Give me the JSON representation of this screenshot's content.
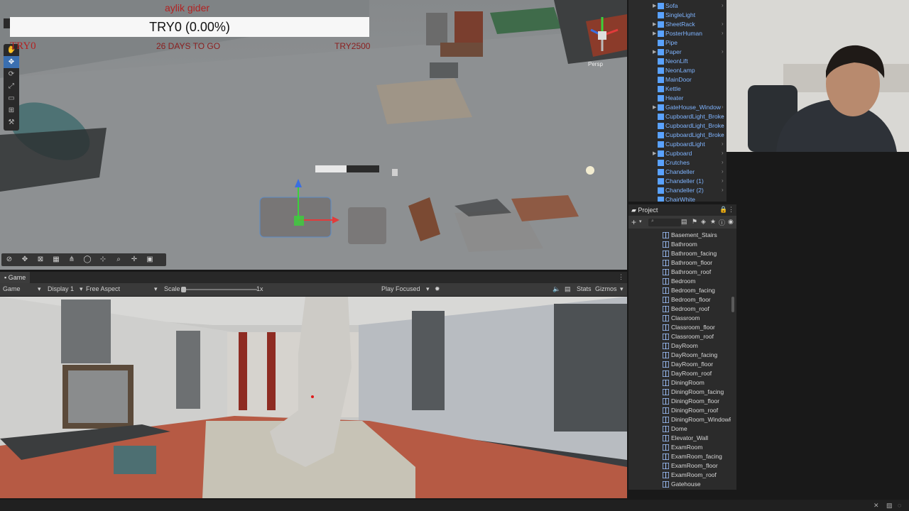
{
  "hud": {
    "alert": "aylik gider",
    "title": "TRY0 (0.00%)",
    "left_label": "TRY0",
    "days": "26 DAYS TO GO",
    "right_label": "TRY2500"
  },
  "scene": {
    "view_mode": "Persp",
    "tools": [
      "hand-tool-icon",
      "move-tool-icon",
      "rotate-tool-icon",
      "scale-tool-icon",
      "rect-tool-icon",
      "transform-tool-icon",
      "custom-tool-icon"
    ]
  },
  "game": {
    "tab_label": "Game",
    "mode_label": "Game",
    "display": "Display 1",
    "aspect": "Free Aspect",
    "scale_label": "Scale",
    "scale_value": "1x",
    "play_mode": "Play Focused",
    "stats_label": "Stats",
    "gizmos_label": "Gizmos"
  },
  "hierarchy": {
    "items": [
      {
        "label": "Sofa",
        "expandable": true
      },
      {
        "label": "SingleLight",
        "expandable": false
      },
      {
        "label": "SheetRack",
        "expandable": true
      },
      {
        "label": "PosterHuman",
        "expandable": true
      },
      {
        "label": "Pipe",
        "expandable": false
      },
      {
        "label": "Paper",
        "expandable": true
      },
      {
        "label": "NeonLift",
        "expandable": false
      },
      {
        "label": "NeonLamp",
        "expandable": false
      },
      {
        "label": "MainDoor",
        "expandable": false
      },
      {
        "label": "Kettle",
        "expandable": false
      },
      {
        "label": "Heater",
        "expandable": false
      },
      {
        "label": "GateHouse_Window",
        "expandable": true
      },
      {
        "label": "CupboardLight_Broke",
        "expandable": false
      },
      {
        "label": "CupboardLight_Broke",
        "expandable": false
      },
      {
        "label": "CupboardLight_Broke",
        "expandable": false
      },
      {
        "label": "CupboardLight",
        "expandable": false
      },
      {
        "label": "Cupboard",
        "expandable": true
      },
      {
        "label": "Crutches",
        "expandable": false
      },
      {
        "label": "Chandeller",
        "expandable": false
      },
      {
        "label": "Chandeller (1)",
        "expandable": false
      },
      {
        "label": "Chandeller (2)",
        "expandable": false
      },
      {
        "label": "ChairWhite",
        "expandable": false
      }
    ]
  },
  "project": {
    "tab_label": "Project",
    "items": [
      "Basement_Stairs",
      "Bathroom",
      "Bathroom_facing",
      "Bathroom_floor",
      "Bathroom_roof",
      "Bedroom",
      "Bedroom_facing",
      "Bedroom_floor",
      "Bedroom_roof",
      "Classroom",
      "Classroom_floor",
      "Classroom_roof",
      "DayRoom",
      "DayRoom_facing",
      "DayRoom_floor",
      "DayRoom_roof",
      "DiningRoom",
      "DiningRoom_facing",
      "DiningRoom_floor",
      "DiningRoom_roof",
      "DiningRoom_WindowF",
      "Dome",
      "Elevator_Wall",
      "ExamRoom",
      "ExamRoom_facing",
      "ExamRoom_floor",
      "ExamRoom_roof",
      "Gatehouse"
    ]
  },
  "colors": {
    "accent": "#3a6fb0",
    "hierarchy_text": "#7fb4ff",
    "hud_red": "#b22222",
    "panel_bg": "#2b2b2b"
  }
}
